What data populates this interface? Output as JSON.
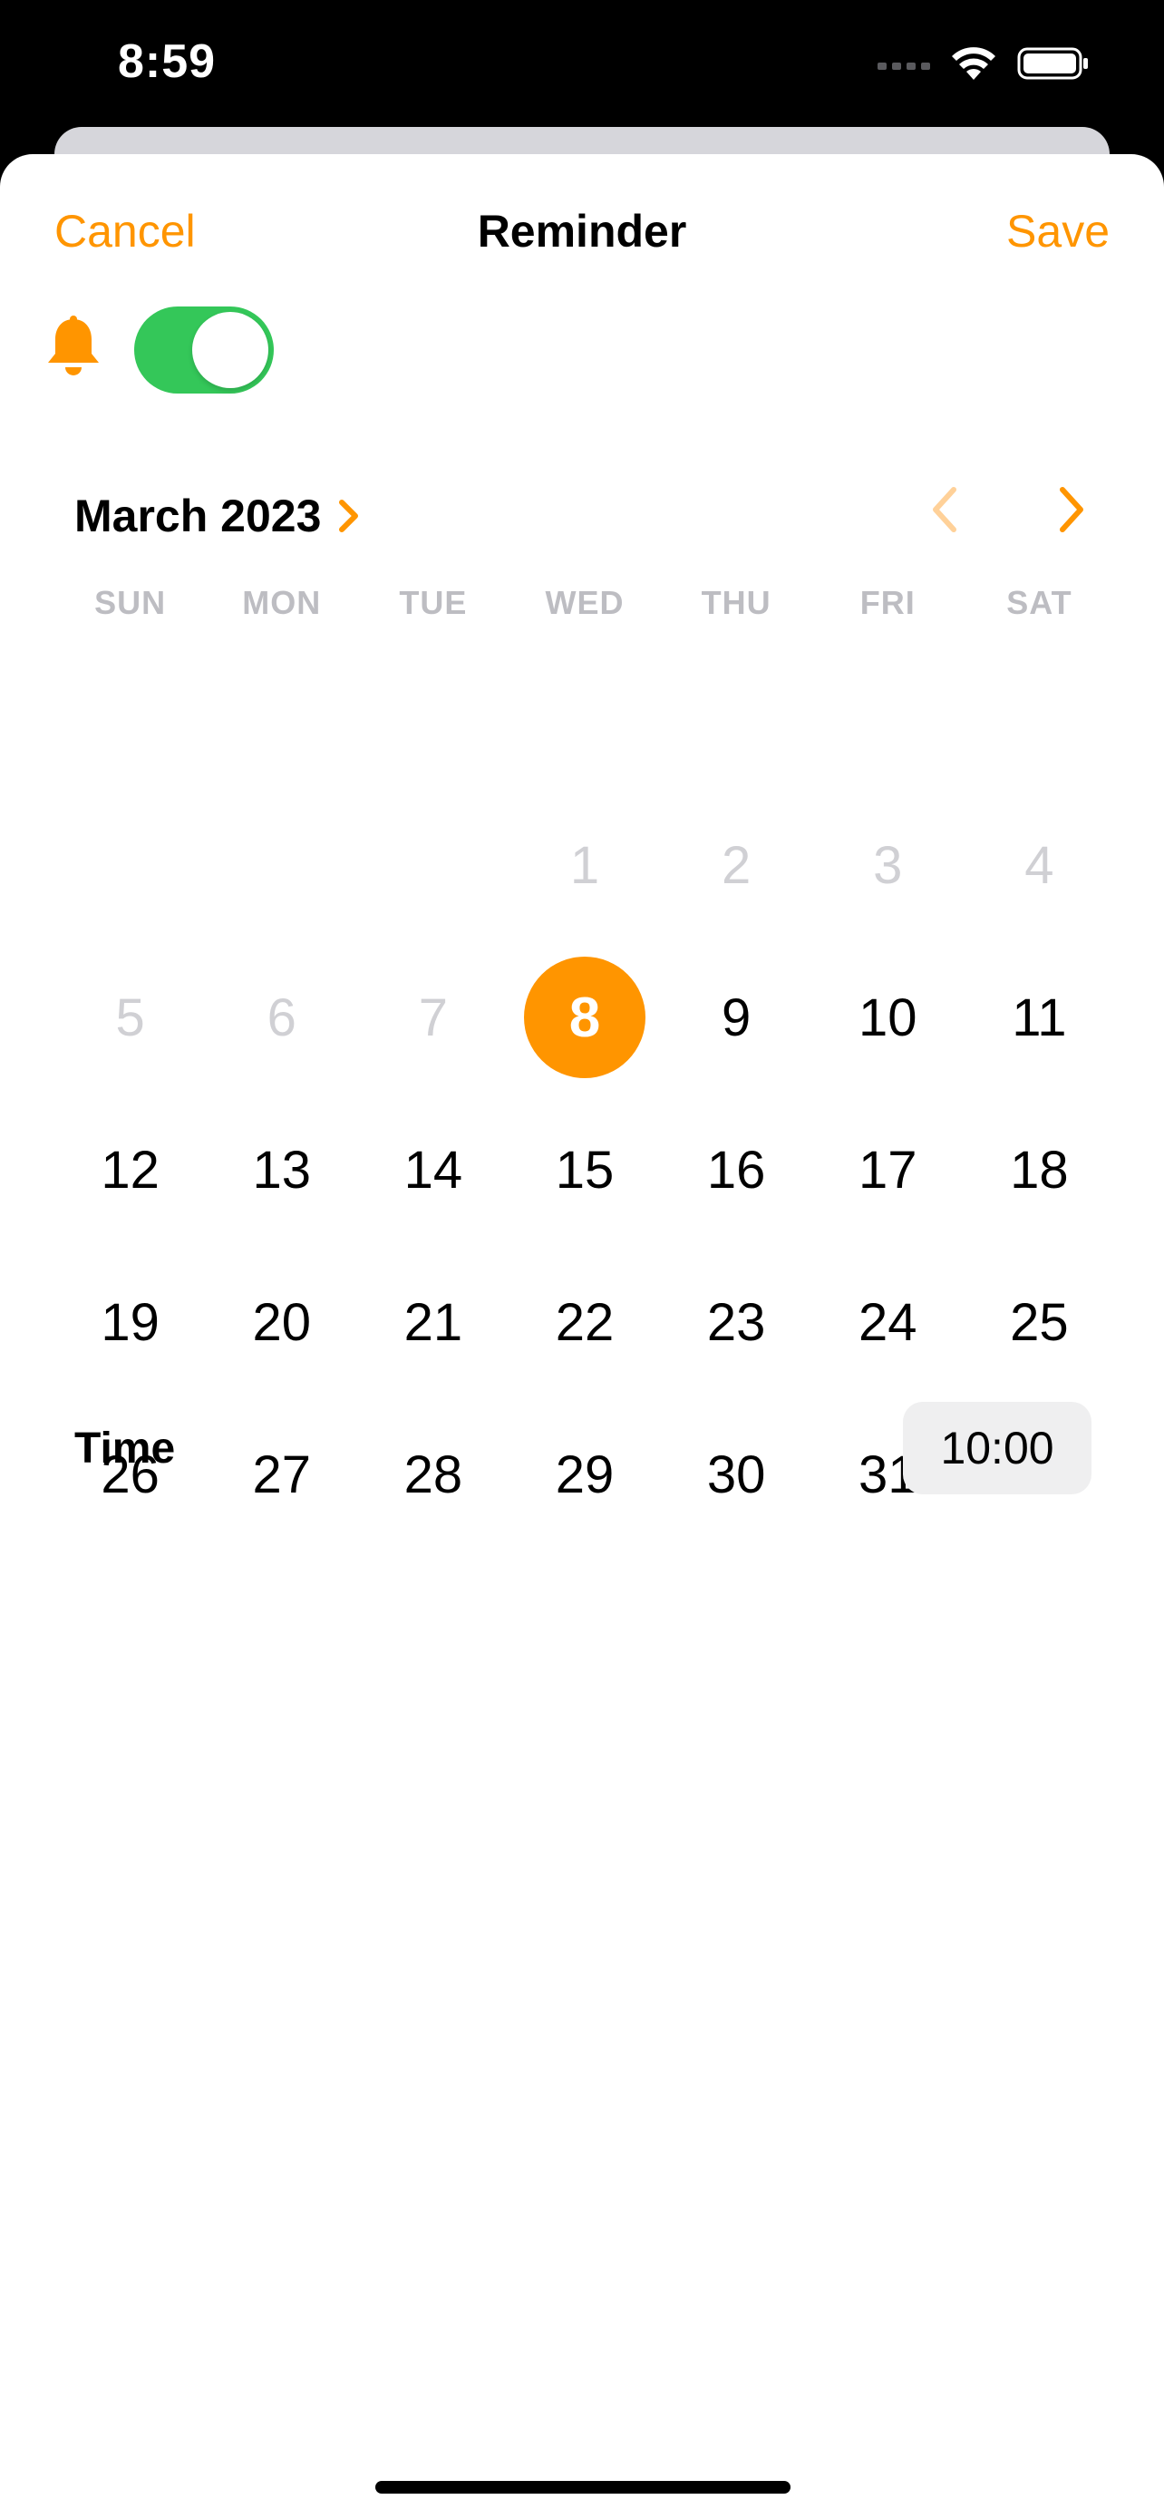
{
  "status_bar": {
    "time": "8:59",
    "icons": [
      "signal-icon",
      "wifi-icon",
      "battery-icon"
    ]
  },
  "nav": {
    "cancel_label": "Cancel",
    "title": "Reminder",
    "save_label": "Save"
  },
  "reminder": {
    "enabled": true
  },
  "calendar": {
    "month_label": "March 2023",
    "weekdays": [
      "SUN",
      "MON",
      "TUE",
      "WED",
      "THU",
      "FRI",
      "SAT"
    ],
    "days": [
      {
        "label": "",
        "dim": false
      },
      {
        "label": "",
        "dim": false
      },
      {
        "label": "",
        "dim": false
      },
      {
        "label": "1",
        "dim": true
      },
      {
        "label": "2",
        "dim": true
      },
      {
        "label": "3",
        "dim": true
      },
      {
        "label": "4",
        "dim": true
      },
      {
        "label": "5",
        "dim": true
      },
      {
        "label": "6",
        "dim": true
      },
      {
        "label": "7",
        "dim": true
      },
      {
        "label": "8",
        "selected": true
      },
      {
        "label": "9"
      },
      {
        "label": "10"
      },
      {
        "label": "11"
      },
      {
        "label": "12"
      },
      {
        "label": "13"
      },
      {
        "label": "14"
      },
      {
        "label": "15"
      },
      {
        "label": "16"
      },
      {
        "label": "17"
      },
      {
        "label": "18"
      },
      {
        "label": "19"
      },
      {
        "label": "20"
      },
      {
        "label": "21"
      },
      {
        "label": "22"
      },
      {
        "label": "23"
      },
      {
        "label": "24"
      },
      {
        "label": "25"
      },
      {
        "label": "26"
      },
      {
        "label": "27"
      },
      {
        "label": "28"
      },
      {
        "label": "29"
      },
      {
        "label": "30"
      },
      {
        "label": "31"
      }
    ]
  },
  "time": {
    "label": "Time",
    "value": "10:00"
  },
  "colors": {
    "accent": "#ff9500",
    "toggle_on": "#34c759",
    "dim_text": "#d0d0d4"
  }
}
